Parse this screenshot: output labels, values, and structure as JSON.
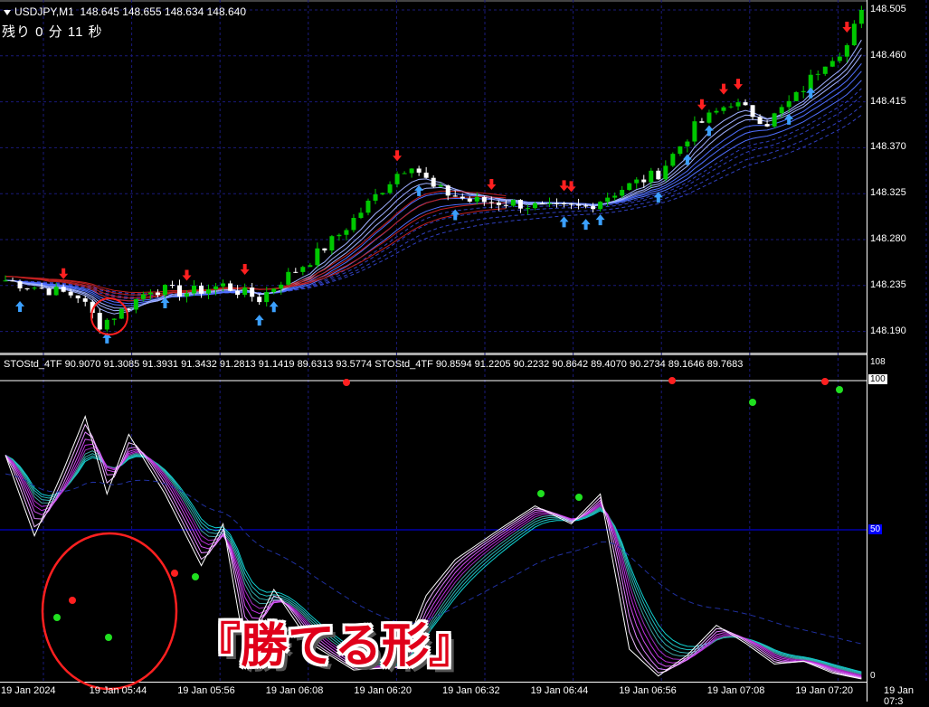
{
  "header": {
    "symbol": "USDJPY,M1",
    "ohlc": "148.645 148.655 148.634 148.640"
  },
  "timer": {
    "text": "残り 0 分 11 秒"
  },
  "indicator": {
    "legend": "STOStd_4TF 90.9070 91.3085 91.3931 91.3432 91.2813 91.1419 89.6313 93.5774  STOStd_4TF 90.8594 91.2205 90.2232 90.8642 89.4070 90.2734 89.1646 89.7683",
    "scale_max": "108",
    "level_100": "100",
    "level_50": "50",
    "level_0": "0",
    "main_line": [
      [
        0,
        75
      ],
      [
        4,
        48
      ],
      [
        8,
        70
      ],
      [
        11,
        88
      ],
      [
        14,
        62
      ],
      [
        17,
        82
      ],
      [
        22,
        62
      ],
      [
        27,
        38
      ],
      [
        30,
        52
      ],
      [
        33,
        10
      ],
      [
        37,
        30
      ],
      [
        42,
        12
      ],
      [
        48,
        3
      ],
      [
        54,
        4
      ],
      [
        58,
        28
      ],
      [
        62,
        40
      ],
      [
        68,
        50
      ],
      [
        73,
        58
      ],
      [
        78,
        52
      ],
      [
        82,
        62
      ],
      [
        86,
        10
      ],
      [
        90,
        1
      ],
      [
        94,
        8
      ],
      [
        98,
        18
      ],
      [
        102,
        12
      ],
      [
        106,
        5
      ],
      [
        110,
        6
      ],
      [
        114,
        2
      ],
      [
        118,
        0
      ]
    ]
  },
  "price_axis": [
    "148.505",
    "148.460",
    "148.415",
    "148.370",
    "148.325",
    "148.280",
    "148.235",
    "148.190"
  ],
  "time_axis": [
    "19 Jan 2024",
    "19 Jan 05:44",
    "19 Jan 05:56",
    "19 Jan 06:08",
    "19 Jan 06:20",
    "19 Jan 06:32",
    "19 Jan 06:44",
    "19 Jan 06:56",
    "19 Jan 07:08",
    "19 Jan 07:20",
    "19 Jan 07:3"
  ],
  "price_path": [
    [
      0,
      148.24
    ],
    [
      5,
      148.232
    ],
    [
      10,
      148.225
    ],
    [
      13,
      148.197
    ],
    [
      16,
      148.21
    ],
    [
      20,
      148.232
    ],
    [
      25,
      148.228
    ],
    [
      30,
      148.235
    ],
    [
      35,
      148.222
    ],
    [
      38,
      148.24
    ],
    [
      42,
      148.26
    ],
    [
      46,
      148.285
    ],
    [
      50,
      148.315
    ],
    [
      54,
      148.345
    ],
    [
      56,
      148.355
    ],
    [
      59,
      148.33
    ],
    [
      64,
      148.318
    ],
    [
      70,
      148.316
    ],
    [
      75,
      148.31
    ],
    [
      80,
      148.312
    ],
    [
      85,
      148.33
    ],
    [
      90,
      148.345
    ],
    [
      95,
      148.39
    ],
    [
      100,
      148.415
    ],
    [
      105,
      148.395
    ],
    [
      109,
      148.42
    ],
    [
      113,
      148.455
    ],
    [
      116,
      148.47
    ],
    [
      118,
      148.505
    ]
  ],
  "annotation": "『勝てる形』",
  "colors": {
    "bull": "#00c800",
    "bear": "#ffffff",
    "grid": "#1a1a7a",
    "buy_arrow": "#3ba0ff",
    "sell_arrow": "#ff2020",
    "circle": "#ff2020"
  }
}
